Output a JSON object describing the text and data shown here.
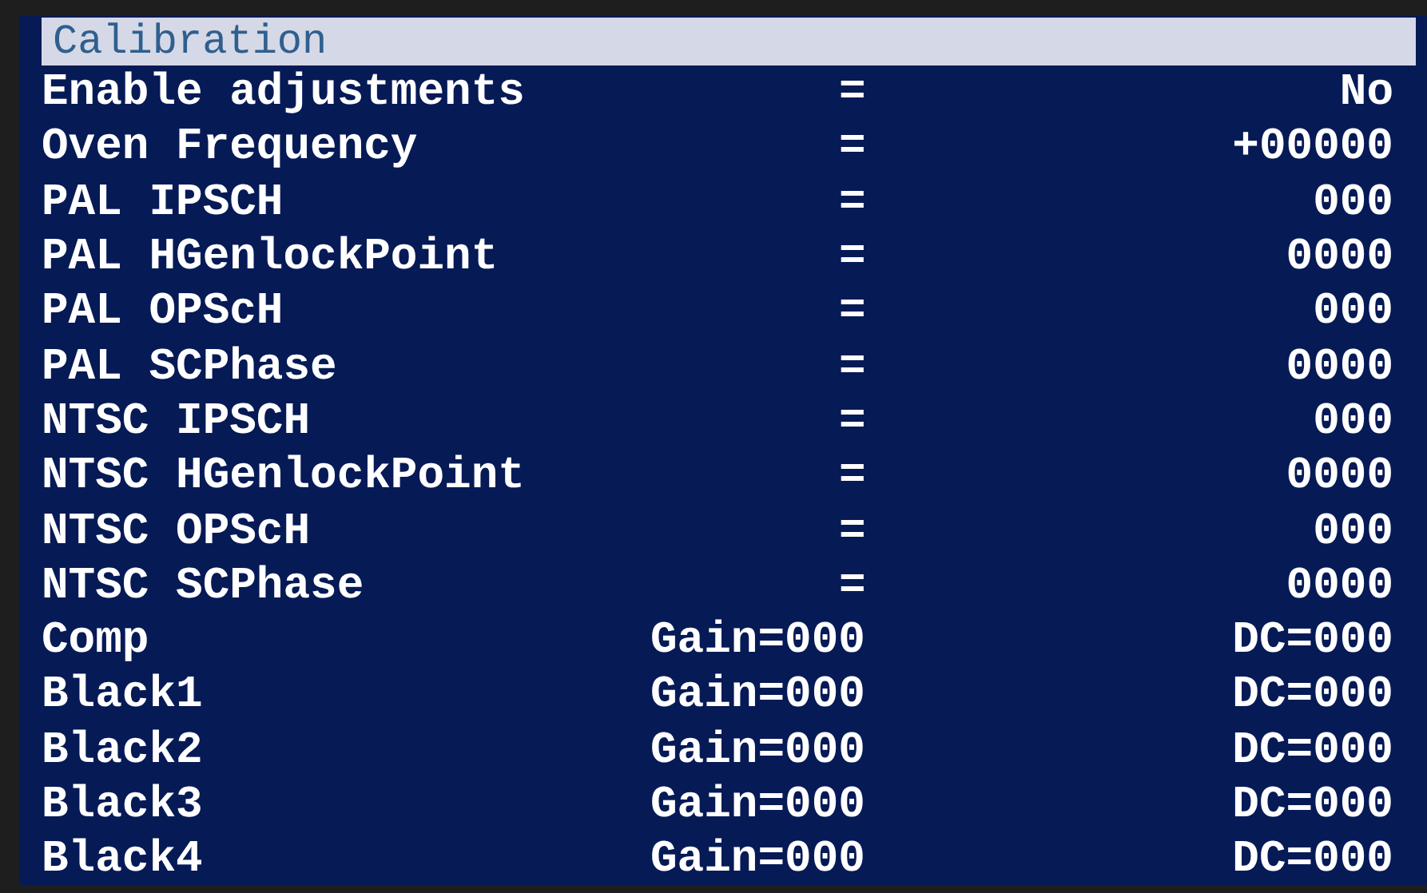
{
  "title": "Calibration",
  "rows": [
    {
      "kind": "setting",
      "label": "Enable adjustments",
      "middle": "=",
      "value": "No"
    },
    {
      "kind": "setting",
      "label": "Oven Frequency",
      "middle": "=",
      "value": "+00000"
    },
    {
      "kind": "setting",
      "label": "PAL IPSCH",
      "middle": "=",
      "value": "000"
    },
    {
      "kind": "setting",
      "label": "PAL HGenlockPoint",
      "middle": "=",
      "value": "0000"
    },
    {
      "kind": "setting",
      "label": "PAL OPScH",
      "middle": "=",
      "value": "000"
    },
    {
      "kind": "setting",
      "label": "PAL SCPhase",
      "middle": "=",
      "value": "0000"
    },
    {
      "kind": "setting",
      "label": "NTSC IPSCH",
      "middle": "=",
      "value": "000"
    },
    {
      "kind": "setting",
      "label": "NTSC HGenlockPoint",
      "middle": "=",
      "value": "0000"
    },
    {
      "kind": "setting",
      "label": "NTSC OPScH",
      "middle": "=",
      "value": "000"
    },
    {
      "kind": "setting",
      "label": "NTSC SCPhase",
      "middle": "=",
      "value": "0000"
    },
    {
      "kind": "gain",
      "label": "Comp",
      "middle": "Gain=000",
      "value": "DC=000"
    },
    {
      "kind": "gain",
      "label": "Black1",
      "middle": "Gain=000",
      "value": "DC=000"
    },
    {
      "kind": "gain",
      "label": "Black2",
      "middle": "Gain=000",
      "value": "DC=000"
    },
    {
      "kind": "gain",
      "label": "Black3",
      "middle": "Gain=000",
      "value": "DC=000"
    },
    {
      "kind": "gain",
      "label": "Black4",
      "middle": "Gain=000",
      "value": "DC=000"
    }
  ]
}
